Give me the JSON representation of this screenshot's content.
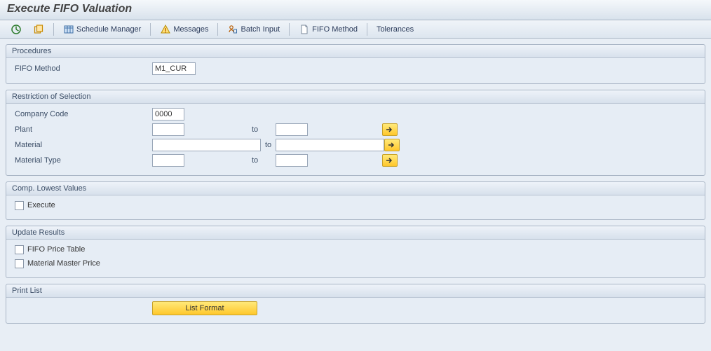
{
  "title": "Execute FIFO Valuation",
  "toolbar": {
    "schedule_manager": "Schedule Manager",
    "messages": "Messages",
    "batch_input": "Batch Input",
    "fifo_method": "FIFO Method",
    "tolerances": "Tolerances"
  },
  "procedures": {
    "title": "Procedures",
    "fifo_method_label": "FIFO Method",
    "fifo_method_value": "M1_CUR"
  },
  "restriction": {
    "title": "Restriction of Selection",
    "company_code_label": "Company Code",
    "company_code_value": "0000",
    "plant_label": "Plant",
    "plant_from": "",
    "plant_to": "",
    "material_label": "Material",
    "material_from": "",
    "material_to": "",
    "material_type_label": "Material Type",
    "material_type_from": "",
    "material_type_to": "",
    "to_label": "to"
  },
  "lowest": {
    "title": "Comp. Lowest Values",
    "execute_label": "Execute"
  },
  "update": {
    "title": "Update Results",
    "fifo_price_label": "FIFO Price Table",
    "mm_price_label": "Material Master Price"
  },
  "print": {
    "title": "Print List",
    "list_format": "List Format"
  }
}
